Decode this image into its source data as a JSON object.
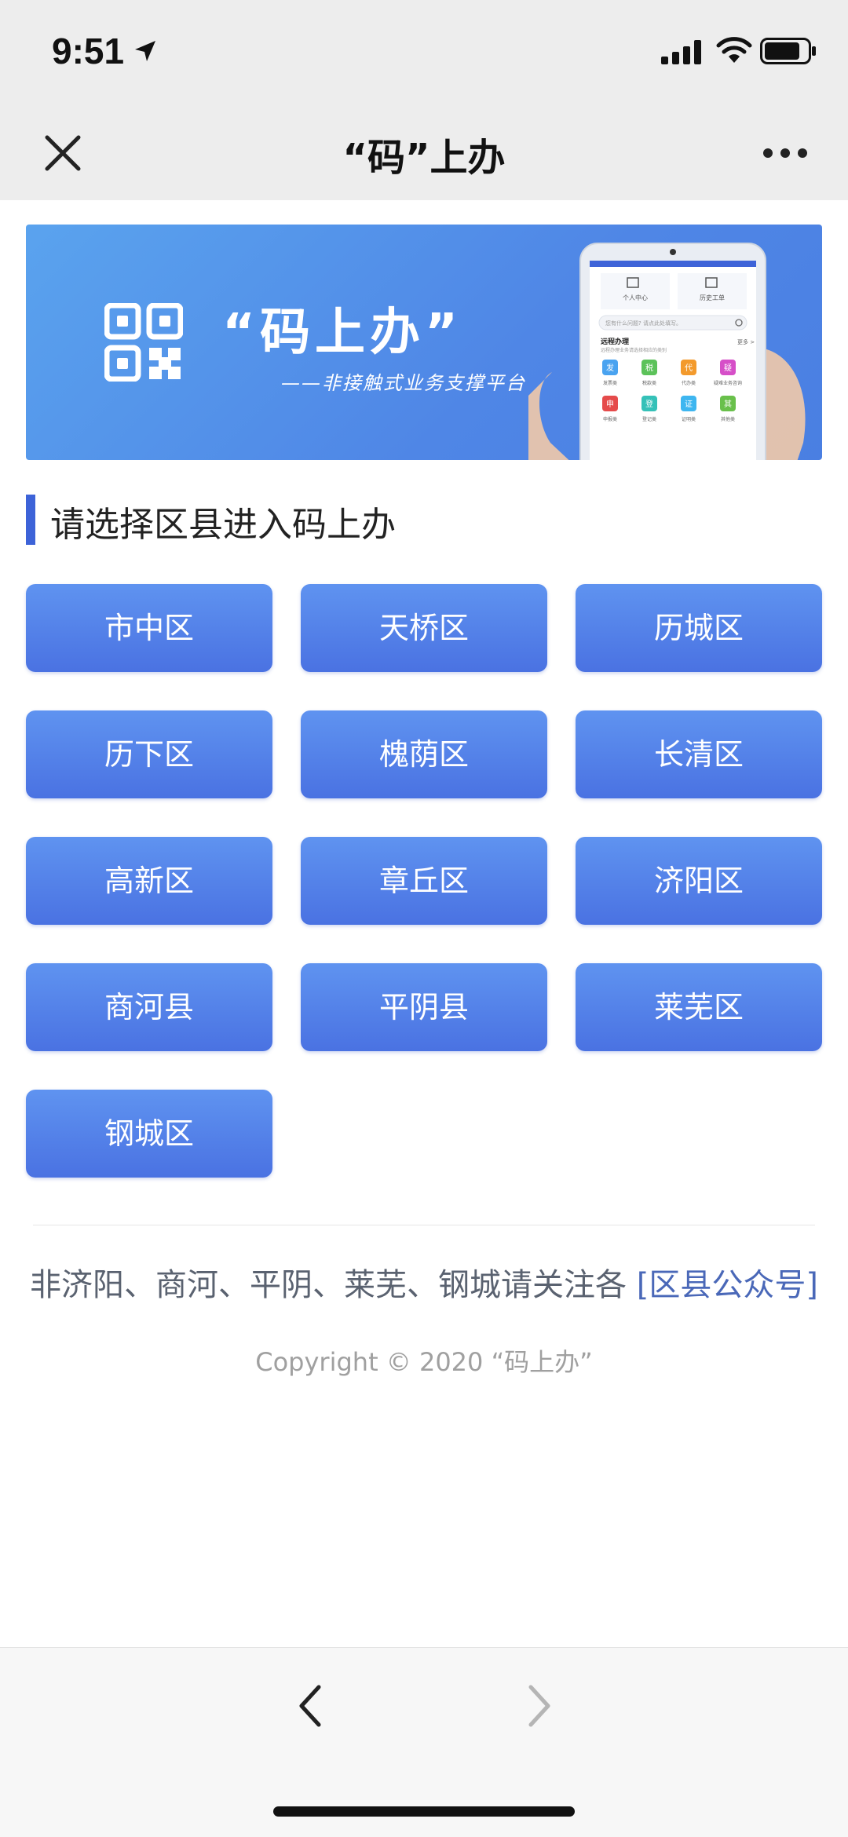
{
  "status_bar": {
    "time": "9:51",
    "icons": [
      "location-arrow-icon",
      "cellular-signal-icon",
      "wifi-icon",
      "battery-icon"
    ]
  },
  "nav": {
    "title": "“码”上办",
    "close_icon": "close-icon",
    "more_icon": "more-icon"
  },
  "banner": {
    "title": "“码上办”",
    "subtitle": "——非接触式业务支撑平台",
    "phone_mock": {
      "tabs": [
        "个人中心",
        "历史工单"
      ],
      "search_placeholder": "您有什么问题? 请点此处填写。",
      "section_title": "远程办理",
      "section_desc": "远程办理业务请选择相应的类别",
      "more_label": "更多 >",
      "apps": [
        {
          "glyph": "发",
          "label": "发票类",
          "color": "#4aa3f0"
        },
        {
          "glyph": "税",
          "label": "税款类",
          "color": "#5cc25a"
        },
        {
          "glyph": "代",
          "label": "代办类",
          "color": "#f39a2c"
        },
        {
          "glyph": "疑",
          "label": "疑难业务咨询",
          "color": "#d64fc8"
        },
        {
          "glyph": "申",
          "label": "申报类",
          "color": "#e54b4b"
        },
        {
          "glyph": "登",
          "label": "登记类",
          "color": "#35c1b8"
        },
        {
          "glyph": "证",
          "label": "证明类",
          "color": "#3eb6f0"
        },
        {
          "glyph": "其",
          "label": "其他类",
          "color": "#69c04b"
        }
      ]
    }
  },
  "section": {
    "title": "请选择区县进入码上办"
  },
  "districts": [
    "市中区",
    "天桥区",
    "历城区",
    "历下区",
    "槐荫区",
    "长清区",
    "高新区",
    "章丘区",
    "济阳区",
    "商河县",
    "平阴县",
    "莱芜区",
    "钢城区"
  ],
  "footer": {
    "notice": "非济阳、商河、平阴、莱芜、钢城请关注各",
    "notice_link": "[区县公众号]",
    "copyright": "Copyright © 2020 “码上办”"
  },
  "bottom_bar": {
    "icons": [
      "back-arrow-icon",
      "forward-arrow-icon"
    ]
  },
  "colors": {
    "accent": "#3d63d8",
    "button_top": "#5f93f0",
    "button_bottom": "#4a72e2",
    "banner": "#4f86e6",
    "header_bg": "#ededed"
  }
}
